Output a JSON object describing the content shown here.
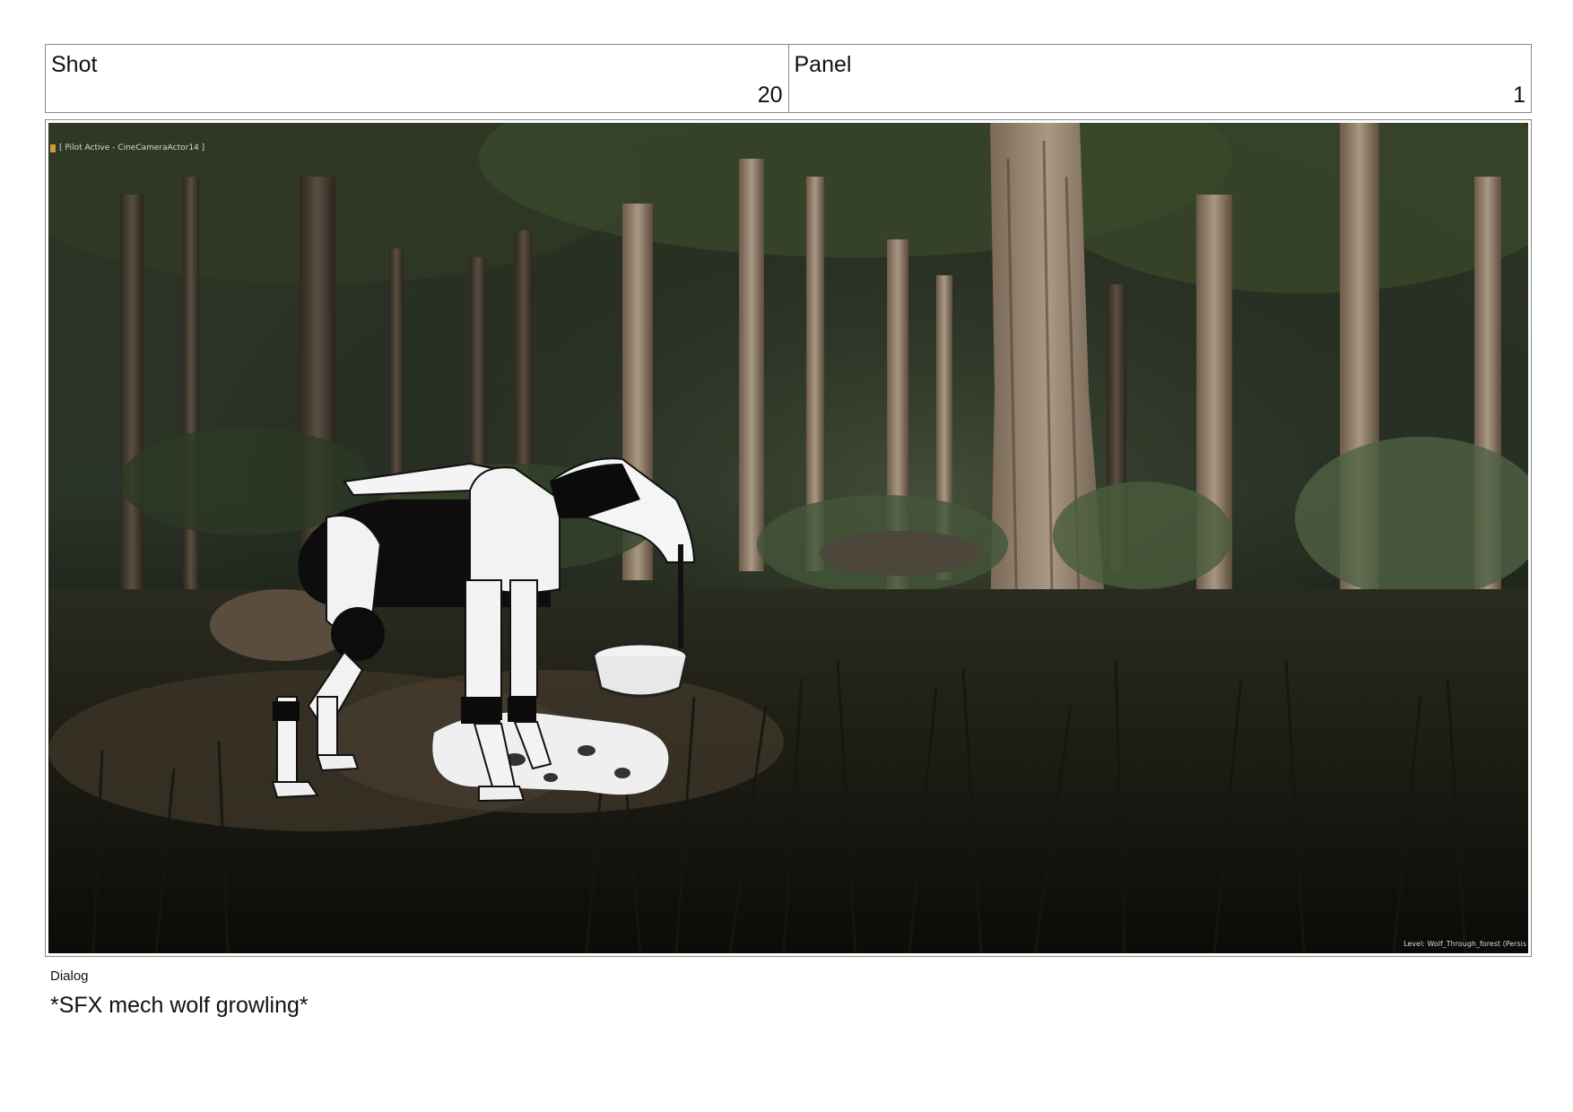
{
  "header": {
    "shot_label": "Shot",
    "shot_value": "20",
    "panel_label": "Panel",
    "panel_value": "1"
  },
  "image": {
    "description": "Storyboard panel: forest scene with a drawn mech wolf drinking from a bowl",
    "pilot_overlay": "[ Pilot Active - CineCameraActor14 ]",
    "level_overlay": "Level:  Wolf_Through_forest (Persis"
  },
  "dialog": {
    "label": "Dialog",
    "text": "*SFX mech wolf growling*"
  }
}
